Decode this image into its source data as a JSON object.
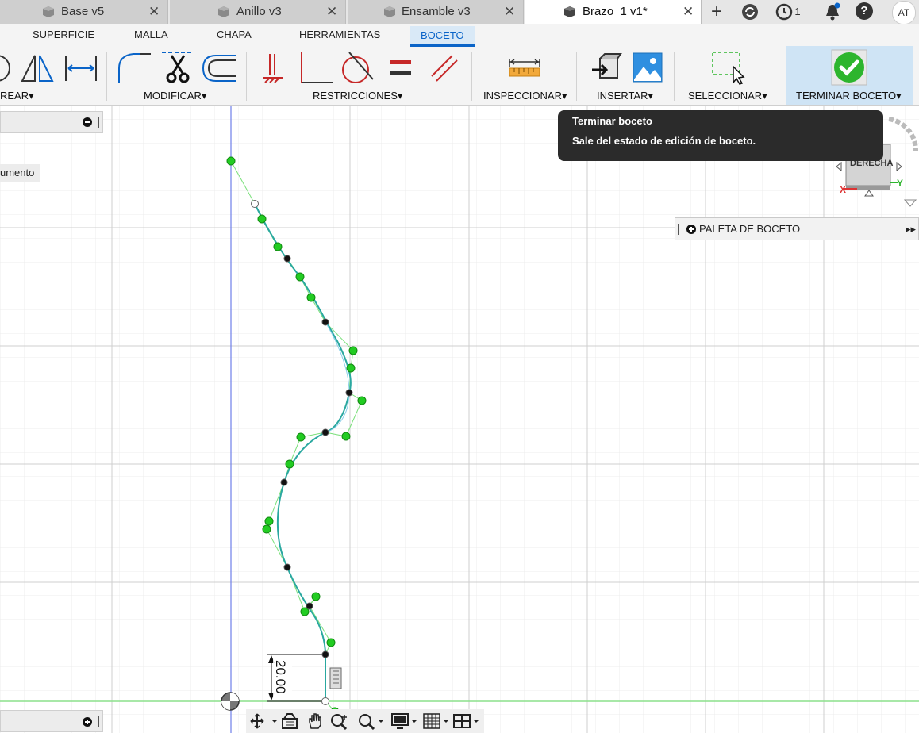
{
  "tabs": [
    {
      "label": "Base v5",
      "active": false
    },
    {
      "label": "Anillo v3",
      "active": false
    },
    {
      "label": "Ensamble v3",
      "active": false
    },
    {
      "label": "Brazo_1 v1*",
      "active": true
    }
  ],
  "top_icons": {
    "new_tab": "+",
    "jobs_count": "1",
    "help": "?",
    "user_initials": "AT"
  },
  "ribbon": {
    "menu_tabs": [
      "SUPERFICIE",
      "MALLA",
      "CHAPA",
      "HERRAMIENTAS",
      "BOCETO"
    ],
    "active_tab": "BOCETO",
    "groups": [
      "REAR",
      "MODIFICAR",
      "RESTRICCIONES",
      "INSPECCIONAR",
      "INSERTAR",
      "SELECCIONAR",
      "TERMINAR BOCETO"
    ],
    "dropdown_glyph": "▾"
  },
  "browser": {
    "partial_item": "umento"
  },
  "tooltip": {
    "title": "Terminar boceto",
    "description": "Sale del estado de edición de boceto."
  },
  "viewcube": {
    "face": "DERECHA",
    "axis_x": "X",
    "axis_y": "Y"
  },
  "palette": {
    "label": "PALETA DE BOCETO",
    "expand_glyph": "▸▸"
  },
  "sketch": {
    "dimension_value": "20.00"
  },
  "colors": {
    "accent": "#0a64c8",
    "spline": "#2aa8a0",
    "control_point": "#22cc22",
    "tooltip_bg": "#2b2b2b",
    "finish_check": "#2db52d"
  }
}
